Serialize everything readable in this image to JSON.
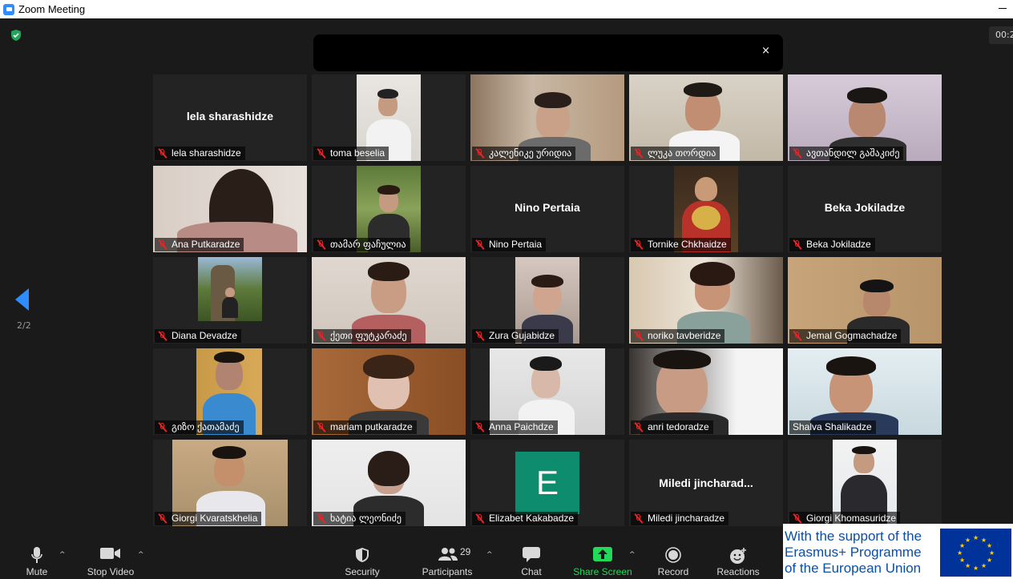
{
  "window": {
    "title": "Zoom Meeting"
  },
  "meeting": {
    "timer": "00:2",
    "close_symbol": "×",
    "page_indicator": "2/2"
  },
  "participants_grid": [
    {
      "name": "lela sharashidze",
      "center_name": "lela sharashidze",
      "muted": true
    },
    {
      "name": "toma beselia",
      "muted": true
    },
    {
      "name": "კალენიკე ურიდია",
      "muted": true
    },
    {
      "name": "ლუკა თორდია",
      "muted": true
    },
    {
      "name": "ავთანდილ გაშაკიძე",
      "muted": true
    },
    {
      "name": "Ana Putkaradze",
      "muted": true
    },
    {
      "name": "თამარ ფაჩულია",
      "muted": true
    },
    {
      "name": "Nino Pertaia",
      "center_name": "Nino Pertaia",
      "muted": true
    },
    {
      "name": "Tornike Chkhaidze",
      "muted": true
    },
    {
      "name": "Beka Jokiladze",
      "center_name": "Beka Jokiladze",
      "muted": true
    },
    {
      "name": "Diana Devadze",
      "muted": true
    },
    {
      "name": "ქეთი ფუტკარაძე",
      "muted": true
    },
    {
      "name": "Zura Gujabidze",
      "muted": true
    },
    {
      "name": "noriko tavberidze",
      "muted": true
    },
    {
      "name": "Jemal Gogmachadze",
      "muted": true
    },
    {
      "name": "გიზო ქათამაძე",
      "muted": true
    },
    {
      "name": "mariam putkaradze",
      "muted": true
    },
    {
      "name": "Anna Paichdze",
      "muted": true
    },
    {
      "name": "anri tedoradze",
      "muted": true
    },
    {
      "name": "Shalva Shalikadze",
      "muted": false
    },
    {
      "name": "Giorgi Kvaratskhelia",
      "muted": true
    },
    {
      "name": "ხატია ლეონიძე",
      "muted": true
    },
    {
      "name": "Elizabet Kakabadze",
      "avatar_letter": "E",
      "muted": true
    },
    {
      "name": "Miledi jincharadze",
      "center_name": "Miledi  jincharad...",
      "muted": true
    },
    {
      "name": "Giorgi Khomasuridze",
      "muted": true
    }
  ],
  "toolbar": {
    "mute": "Mute",
    "stop_video": "Stop Video",
    "security": "Security",
    "participants": "Participants",
    "participants_count": "29",
    "chat": "Chat",
    "share_screen": "Share Screen",
    "record": "Record",
    "reactions": "Reactions",
    "caret": "^"
  },
  "banner": {
    "line1": "With the support of the",
    "line2": "Erasmus+ Programme",
    "line3": "of the European Union"
  },
  "colors": {
    "accent": "#2d8cff",
    "share_green": "#23d959",
    "mute_red": "#e02828",
    "security_green": "#23a559",
    "eu_blue": "#003399",
    "eu_gold": "#ffcc00"
  }
}
